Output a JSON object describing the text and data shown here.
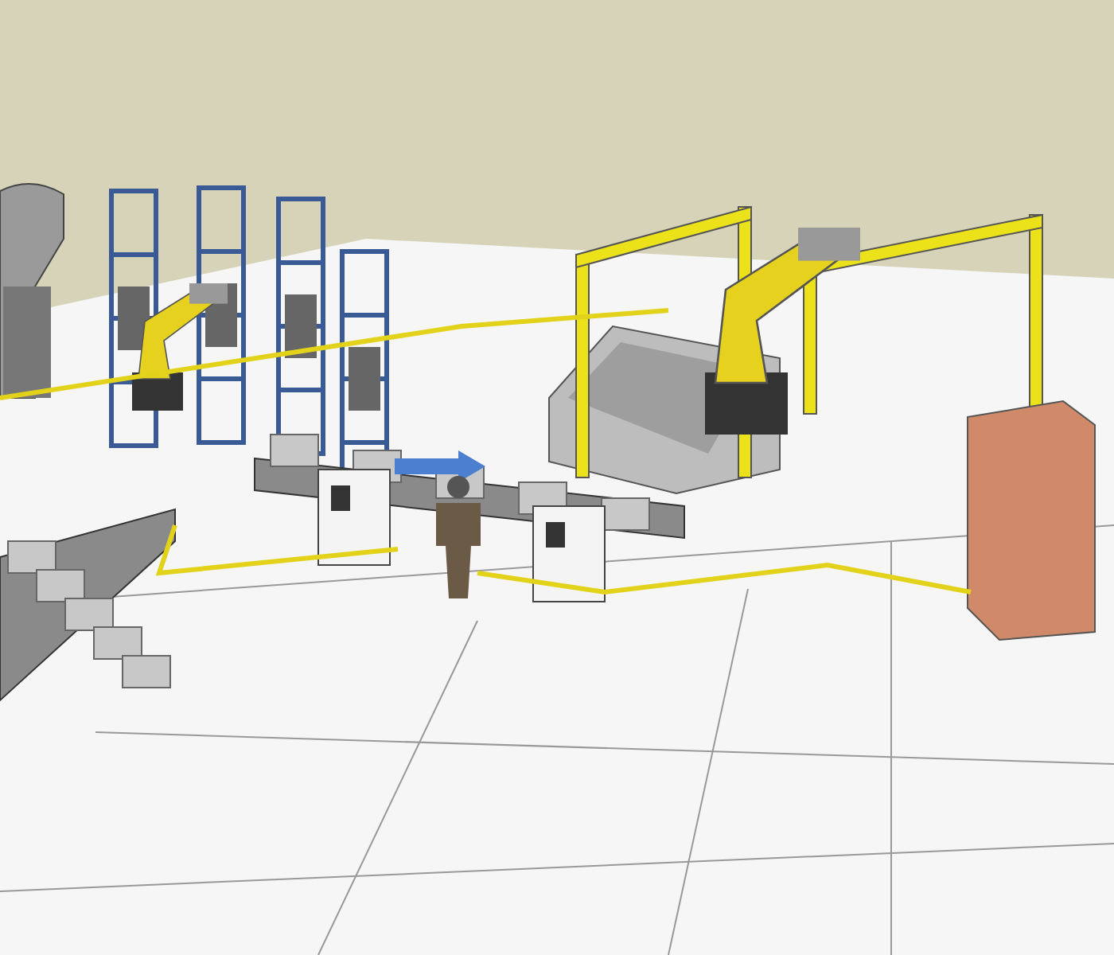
{
  "scene": {
    "objects": [
      {
        "kind": "silo"
      },
      {
        "kind": "rack"
      },
      {
        "kind": "rack"
      },
      {
        "kind": "rack"
      },
      {
        "kind": "rack"
      },
      {
        "kind": "robot"
      },
      {
        "kind": "pit"
      },
      {
        "kind": "gantry"
      },
      {
        "kind": "gantry"
      },
      {
        "kind": "robot"
      },
      {
        "kind": "conveyor"
      },
      {
        "kind": "conveyor"
      },
      {
        "kind": "cabinet"
      },
      {
        "kind": "cabinet"
      },
      {
        "kind": "arrow"
      },
      {
        "kind": "person"
      },
      {
        "kind": "pallet"
      },
      {
        "kind": "fence"
      }
    ]
  }
}
